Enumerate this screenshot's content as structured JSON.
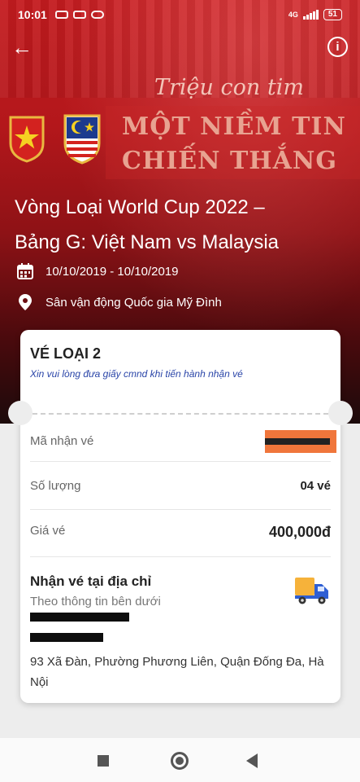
{
  "status_bar": {
    "time": "10:01",
    "network": "4G",
    "battery": "51"
  },
  "header": {
    "back_icon": "arrow-left-icon",
    "info_icon": "info-icon"
  },
  "banner": {
    "script_text": "Triệu con tim",
    "line1": "MỘT NIỀM TIN",
    "line2": "CHIẾN THẮNG"
  },
  "event": {
    "title_line1": "Vòng Loại World Cup 2022 –",
    "title_line2": "Bảng G: Việt Nam vs Malaysia",
    "date": "10/10/2019 - 10/10/2019",
    "venue": "Sân vận động Quốc gia Mỹ Đình"
  },
  "ticket": {
    "type": "VÉ LOẠI 2",
    "note": "Xin vui lòng đưa giấy cmnd khi tiến hành nhận vé",
    "code_label": "Mã nhận vé",
    "quantity_label": "Số lượng",
    "quantity_value": "04 vé",
    "price_label": "Giá vé",
    "price_value": "400,000đ"
  },
  "pickup": {
    "title": "Nhận vé tại địa chỉ",
    "subtitle": "Theo thông tin bên dưới",
    "address": "93 Xã Đàn, Phường Phương Liên, Quận Đống Đa, Hà Nội"
  },
  "colors": {
    "brand_red": "#c41b1f",
    "note_blue": "#2a45a8",
    "redaction_orange": "#f0763b"
  }
}
